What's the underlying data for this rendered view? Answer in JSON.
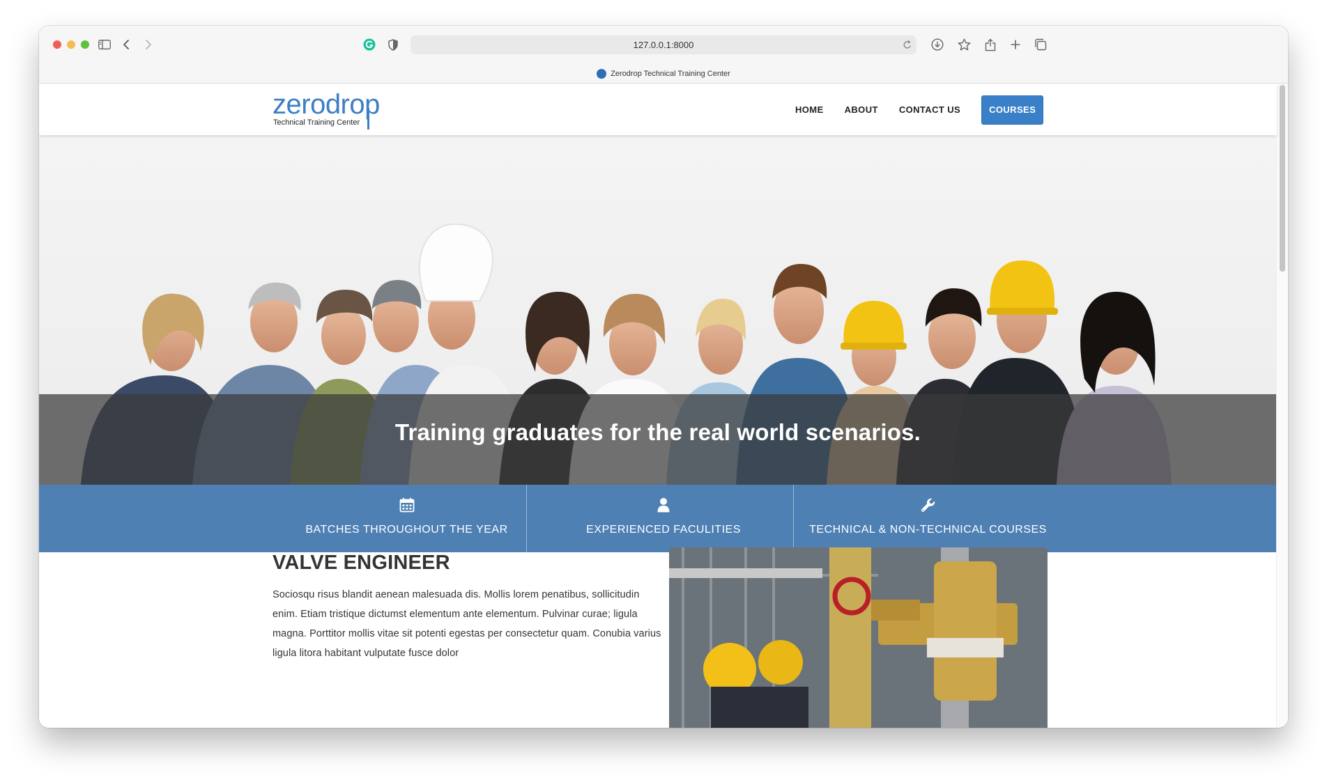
{
  "browser": {
    "url": "127.0.0.1:8000",
    "tab_title": "Zerodrop Technical Training Center"
  },
  "site": {
    "logo": {
      "name": "zerodrop",
      "tagline": "Technical Training Center"
    },
    "nav": [
      {
        "label": "HOME"
      },
      {
        "label": "ABOUT"
      },
      {
        "label": "CONTACT US"
      }
    ],
    "nav_cta": "COURSES",
    "accent_color": "#3a80c9",
    "feature_band_color": "#4e80b4"
  },
  "hero": {
    "heading": "Training graduates for the real world scenarios."
  },
  "features": [
    {
      "icon": "calendar-icon",
      "label": "BATCHES THROUGHOUT THE YEAR"
    },
    {
      "icon": "user-icon",
      "label": "EXPERIENCED FACULITIES"
    },
    {
      "icon": "wrench-icon",
      "label": "TECHNICAL & NON-TECHNICAL COURSES"
    }
  ],
  "section": {
    "title": "VALVE ENGINEER",
    "body": "Sociosqu risus blandit aenean malesuada dis. Mollis lorem penatibus, sollicitudin enim. Etiam tristique dictumst elementum ante elementum. Pulvinar curae; ligula magna. Porttitor mollis vitae sit potenti egestas per consectetur quam. Conubia varius ligula litora habitant vulputate fusce dolor"
  }
}
